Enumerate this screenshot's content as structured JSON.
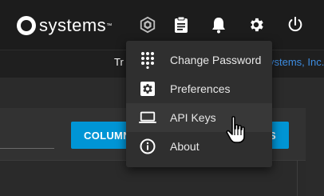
{
  "header": {
    "logo_text": "systems",
    "logo_tm": "™",
    "icons": [
      "truecommand-icon",
      "clipboard-icon",
      "bell-icon",
      "gear-icon",
      "power-icon"
    ]
  },
  "subbar": {
    "text_prefix": "Tr",
    "link_text": "ystems, Inc."
  },
  "content": {
    "columns_button": "COLUMN",
    "right_button": "S"
  },
  "menu": {
    "items": [
      {
        "label": "Change Password",
        "icon": "dialpad-icon"
      },
      {
        "label": "Preferences",
        "icon": "settings-box-icon"
      },
      {
        "label": "API Keys",
        "icon": "laptop-icon"
      },
      {
        "label": "About",
        "icon": "info-icon"
      }
    ],
    "hovered_index": 2
  },
  "colors": {
    "accent": "#0095d5",
    "link": "#3d8ce0",
    "topbar": "#1c1c1c",
    "menu_bg": "#2f2f2f"
  }
}
